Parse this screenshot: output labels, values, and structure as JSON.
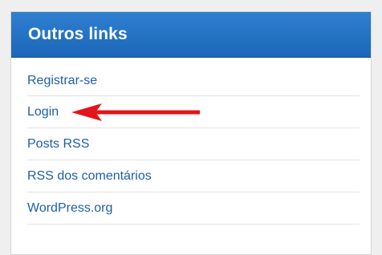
{
  "widget": {
    "title": "Outros links",
    "links": [
      {
        "label": "Registrar-se"
      },
      {
        "label": "Login"
      },
      {
        "label": "Posts RSS"
      },
      {
        "label": "RSS dos comentários"
      },
      {
        "label": "WordPress.org"
      }
    ]
  },
  "colors": {
    "header_blue": "#1b67b8",
    "link_blue": "#1e5fa8",
    "annotation_red": "#e3141b"
  },
  "annotation": {
    "icon": "red-arrow-icon",
    "points_to": "Login"
  }
}
